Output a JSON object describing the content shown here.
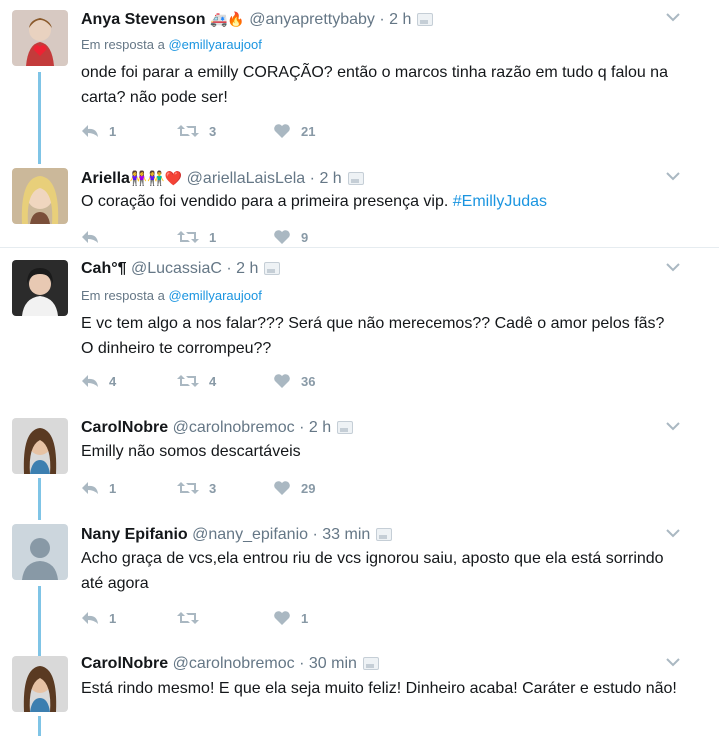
{
  "tweets": [
    {
      "name": "Anya Stevenson",
      "emojis": "🚑🔥",
      "handle": "@anyaprettybaby",
      "time": "2 h",
      "reply_prefix": "Em resposta a",
      "reply_handle": "@emillyaraujoof",
      "text": "onde foi parar a emilly CORAÇÃO? então o marcos tinha razão em tudo q falou na carta? não pode ser!",
      "replies": "1",
      "retweets": "3",
      "likes": "21"
    },
    {
      "name": "Ariella",
      "emojis": "👭👫❤️",
      "handle": "@ariellaLaisLela",
      "time": "2 h",
      "text_plain": "O coração foi vendido para a primeira presença vip.",
      "hashtag": "#EmillyJudas",
      "replies": "",
      "retweets": "1",
      "likes": "9"
    },
    {
      "name": "Cah°¶",
      "handle": "@LucassiaC",
      "time": "2 h",
      "reply_prefix": "Em resposta a",
      "reply_handle": "@emillyaraujoof",
      "text": "E vc tem algo a nos falar??? Será que não merecemos?? Cadê o amor pelos fãs? O dinheiro te corrompeu??",
      "replies": "4",
      "retweets": "4",
      "likes": "36"
    },
    {
      "name": "CarolNobre",
      "handle": "@carolnobremoc",
      "time": "2 h",
      "text": "Emilly não somos descartáveis",
      "replies": "1",
      "retweets": "3",
      "likes": "29"
    },
    {
      "name": "Nany Epifanio",
      "handle": "@nany_epifanio",
      "time": "33 min",
      "text": "Acho graça de vcs,ela entrou riu de vcs ignorou saiu, aposto que ela está sorrindo até agora",
      "replies": "1",
      "retweets": "",
      "likes": "1"
    },
    {
      "name": "CarolNobre",
      "handle": "@carolnobremoc",
      "time": "30 min",
      "text": "Está rindo mesmo! E que ela seja muito feliz! Dinheiro acaba! Caráter e estudo não!"
    }
  ],
  "separator": "·",
  "colors": {
    "thread_line": "#7fc4e6",
    "link": "#1b95e0",
    "muted": "#657786",
    "icon": "#aab8c2"
  },
  "icons": {
    "reply": "reply-icon",
    "retweet": "retweet-icon",
    "like": "heart-icon",
    "caret": "chevron-down-icon",
    "media": "media-icon"
  }
}
